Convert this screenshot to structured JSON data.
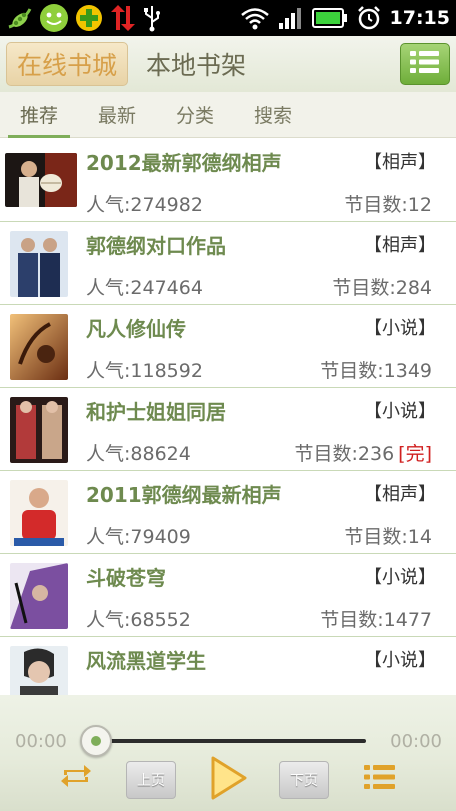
{
  "status_bar": {
    "time": "17:15",
    "icons": [
      "pea-pod-icon",
      "smiley-icon",
      "plus-icon",
      "sync-arrows-icon",
      "usb-icon",
      "wifi-icon",
      "signal-icon",
      "battery-icon",
      "alarm-icon"
    ]
  },
  "header": {
    "tabs": [
      {
        "label": "在线书城",
        "active": true
      },
      {
        "label": "本地书架",
        "active": false
      }
    ],
    "menu_icon": "list-icon"
  },
  "subtabs": [
    {
      "label": "推荐",
      "active": true
    },
    {
      "label": "最新",
      "active": false
    },
    {
      "label": "分类",
      "active": false
    },
    {
      "label": "搜索",
      "active": false
    }
  ],
  "items": [
    {
      "title": "2012最新郭德纲相声",
      "tag": "【相声】",
      "popularity": "人气:274982",
      "episodes": "节目数:12",
      "completed": ""
    },
    {
      "title": "郭德纲对口作品",
      "tag": "【相声】",
      "popularity": "人气:247464",
      "episodes": "节目数:284",
      "completed": ""
    },
    {
      "title": "凡人修仙传",
      "tag": "【小说】",
      "popularity": "人气:118592",
      "episodes": "节目数:1349",
      "completed": ""
    },
    {
      "title": "和护士姐姐同居",
      "tag": "【小说】",
      "popularity": "人气:88624",
      "episodes": "节目数:236",
      "completed": "[完]"
    },
    {
      "title": "2011郭德纲最新相声",
      "tag": "【相声】",
      "popularity": "人气:79409",
      "episodes": "节目数:14",
      "completed": ""
    },
    {
      "title": "斗破苍穹",
      "tag": "【小说】",
      "popularity": "人气:68552",
      "episodes": "节目数:1477",
      "completed": ""
    },
    {
      "title": "风流黑道学生",
      "tag": "【小说】",
      "popularity": "",
      "episodes": "",
      "completed": ""
    }
  ],
  "player": {
    "elapsed": "00:00",
    "total": "00:00",
    "progress": 0,
    "prev_label": "上页",
    "next_label": "下页",
    "icons": [
      "repeat-icon",
      "play-icon",
      "playlist-icon"
    ]
  },
  "colors": {
    "accent_green": "#7fae5a",
    "title_green": "#6e8a4f",
    "active_tab_text": "#d7a04a",
    "completed_red": "#d02020"
  }
}
